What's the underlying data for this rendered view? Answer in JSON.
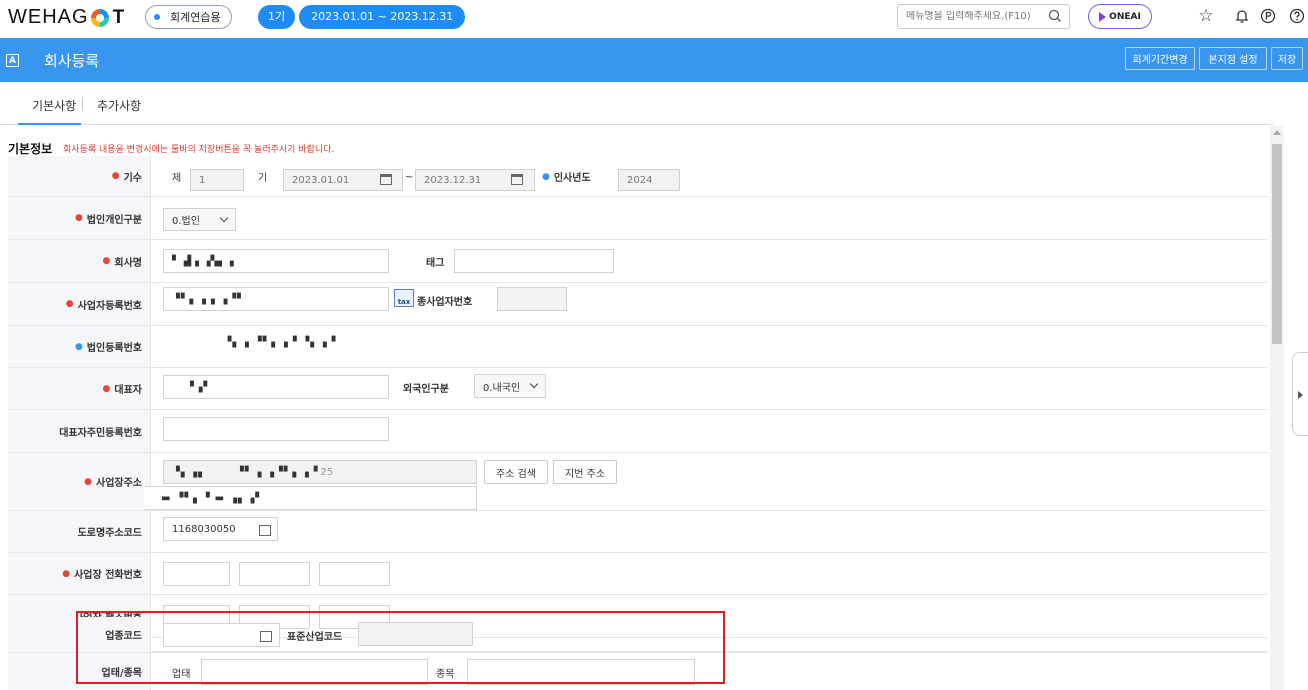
{
  "topbar": {
    "logo_prefix": "WEHAG",
    "logo_suffix": "T",
    "company_name": "회계연습용",
    "period_no": "1기",
    "period_range": "2023.01.01 ~ 2023.12.31",
    "menu_search_placeholder": "메뉴명을 입력해주세요.(F10)",
    "oneai_label": "ONEAI",
    "icons": [
      "star-icon",
      "bell-icon",
      "p-circle-icon",
      "help-icon"
    ]
  },
  "titlebar": {
    "app_icon": "A",
    "title": "회사등록",
    "buttons": [
      "회계기간변경",
      "본지점 설정",
      "저장"
    ]
  },
  "tabs": [
    "기본사항",
    "추가사항"
  ],
  "section": {
    "title": "기본정보",
    "note": "회사등록 내용을 변경시에는 툴바의 저장버튼을 꼭 눌러주시기 바랍니다."
  },
  "form": {
    "period": {
      "label": "기수",
      "prefix": "제",
      "value": "1",
      "suffix": "기",
      "start": "2023.01.01",
      "tilde": "~",
      "end": "2023.12.31",
      "hr_year_label": "인사년도",
      "hr_year": "2024"
    },
    "corp_type": {
      "label": "법인개인구분",
      "value": "0.법인"
    },
    "company_name": {
      "label": "회사명",
      "tag_label": "태그"
    },
    "biz_reg_no": {
      "label": "사업자등록번호",
      "sub_biz_label": "종사업자번호"
    },
    "corp_reg_no": {
      "label": "법인등록번호"
    },
    "ceo": {
      "label": "대표자",
      "foreign_label": "외국인구분",
      "foreign_value": "0.내국인"
    },
    "ceo_id": {
      "label": "대표자주민등록번호"
    },
    "address": {
      "label": "사업장주소",
      "addr_tail": "25",
      "search_btn": "주소 검색",
      "jibun_btn": "지번 주소"
    },
    "road_code": {
      "label": "도로명주소코드",
      "value": "1168030050"
    },
    "phone": {
      "label": "사업장 전화번호"
    },
    "fax": {
      "label": "사업장 팩스번호"
    },
    "industry_code": {
      "label": "업종코드",
      "std_label": "표준산업코드"
    },
    "biz_type": {
      "label": "업태/종목",
      "type_label": "업태",
      "item_label": "종목"
    }
  },
  "colors": {
    "accent": "#3896ee",
    "required": "#e0463a",
    "highlight_box": "#e01e1e"
  }
}
